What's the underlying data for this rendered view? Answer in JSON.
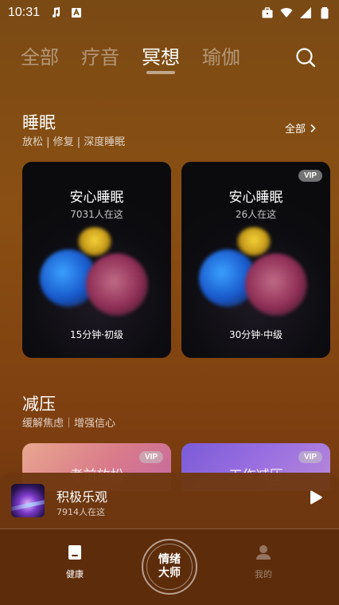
{
  "status_bar": {
    "time": "10:31",
    "left_icons": [
      "music-note-icon",
      "app-badge-icon"
    ],
    "right_icons": [
      "briefcase-icon",
      "wifi-icon",
      "cellular-icon",
      "battery-icon"
    ]
  },
  "tabs": [
    {
      "label": "全部",
      "active": false
    },
    {
      "label": "疗音",
      "active": false
    },
    {
      "label": "冥想",
      "active": true
    },
    {
      "label": "瑜伽",
      "active": false
    }
  ],
  "sections": {
    "sleep": {
      "title": "睡眠",
      "subtitle": "放松 | 修复 | 深度睡眠",
      "see_all": "全部",
      "cards": [
        {
          "title": "安心睡眠",
          "count": "7031人在这",
          "meta": "15分钟·初级",
          "vip": false
        },
        {
          "title": "安心睡眠",
          "count": "26人在这",
          "meta": "30分钟·中级",
          "vip": true,
          "vip_label": "VIP"
        }
      ]
    },
    "stress": {
      "title": "减压",
      "subtitle": "缓解焦虑｜增强信心",
      "cards": [
        {
          "label": "考前放松",
          "vip_label": "VIP"
        },
        {
          "label": "工作减压",
          "vip_label": "VIP"
        }
      ]
    }
  },
  "player": {
    "title": "积极乐观",
    "subtitle": "7914人在这"
  },
  "bottom_nav": {
    "home_label": "健康",
    "center_line1": "情绪",
    "center_line2": "大师",
    "profile_label": "我的"
  },
  "colors": {
    "background_top": "#7a4a14",
    "background_bottom": "#5e2d0c",
    "nav_bg": "#5d2c0b",
    "card_bg": "#0b0b0d"
  }
}
